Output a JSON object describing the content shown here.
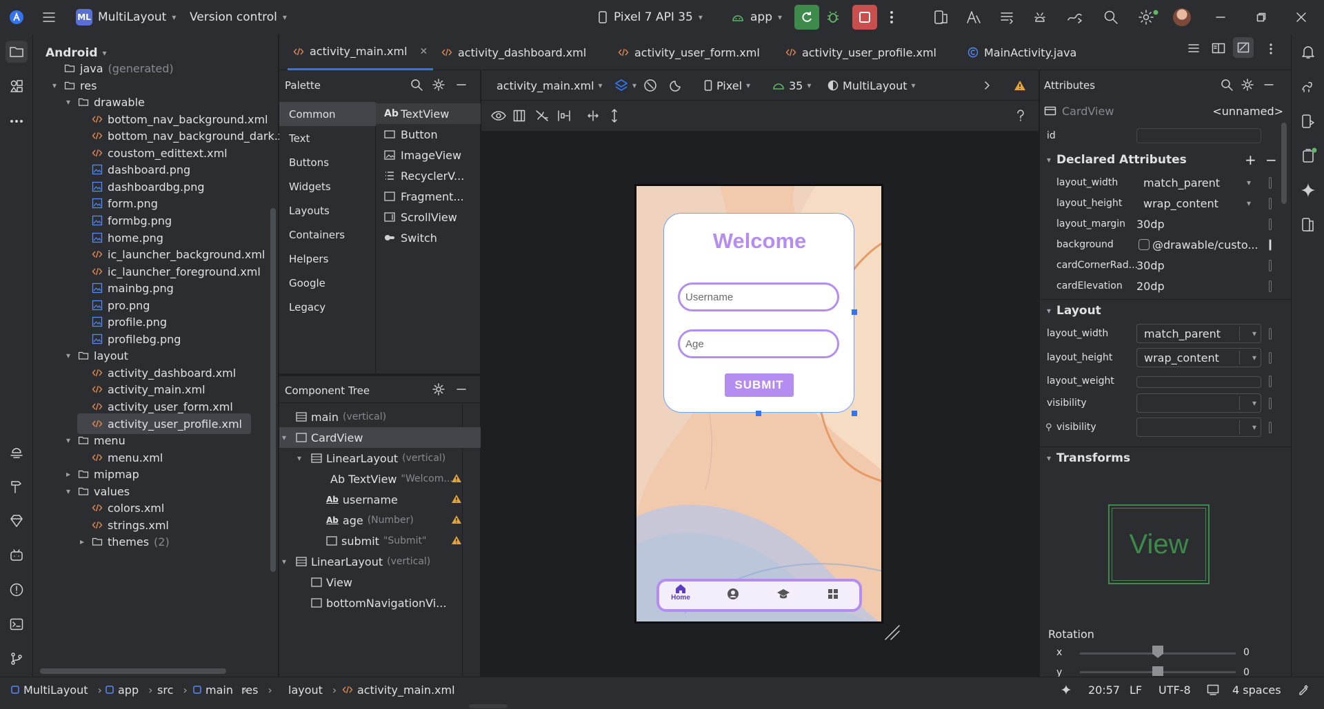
{
  "titlebar": {
    "project_badge": "ML",
    "project_name": "MultiLayout",
    "vcs": "Version control",
    "device": "Pixel 7 API 35",
    "run_config": "app"
  },
  "project_panel": {
    "title": "Android",
    "items": [
      {
        "label": "java",
        "sub": "(generated)",
        "kind": "folder"
      },
      {
        "label": "res",
        "kind": "folder"
      },
      {
        "label": "drawable",
        "kind": "folder"
      },
      {
        "label": "bottom_nav_background.xml",
        "kind": "xml"
      },
      {
        "label": "bottom_nav_background_dark.xml",
        "kind": "xml"
      },
      {
        "label": "coustom_edittext.xml",
        "kind": "xml"
      },
      {
        "label": "dashboard.png",
        "kind": "img"
      },
      {
        "label": "dashboardbg.png",
        "kind": "img"
      },
      {
        "label": "form.png",
        "kind": "img"
      },
      {
        "label": "formbg.png",
        "kind": "img"
      },
      {
        "label": "home.png",
        "kind": "img"
      },
      {
        "label": "ic_launcher_background.xml",
        "kind": "xml"
      },
      {
        "label": "ic_launcher_foreground.xml",
        "kind": "xml"
      },
      {
        "label": "mainbg.png",
        "kind": "img"
      },
      {
        "label": "pro.png",
        "kind": "img"
      },
      {
        "label": "profile.png",
        "kind": "img"
      },
      {
        "label": "profilebg.png",
        "kind": "img"
      },
      {
        "label": "layout",
        "kind": "folder"
      },
      {
        "label": "activity_dashboard.xml",
        "kind": "xml"
      },
      {
        "label": "activity_main.xml",
        "kind": "xml"
      },
      {
        "label": "activity_user_form.xml",
        "kind": "xml"
      },
      {
        "label": "activity_user_profile.xml",
        "kind": "xml"
      },
      {
        "label": "menu",
        "kind": "folder"
      },
      {
        "label": "menu.xml",
        "kind": "xml"
      },
      {
        "label": "mipmap",
        "kind": "folder"
      },
      {
        "label": "values",
        "kind": "folder"
      },
      {
        "label": "colors.xml",
        "kind": "xml"
      },
      {
        "label": "strings.xml",
        "kind": "xml"
      },
      {
        "label": "themes",
        "sub": "(2)",
        "kind": "folder"
      }
    ]
  },
  "tabs": [
    {
      "label": "activity_main.xml",
      "active": true
    },
    {
      "label": "activity_dashboard.xml"
    },
    {
      "label": "activity_user_form.xml"
    },
    {
      "label": "activity_user_profile.xml"
    },
    {
      "label": "MainActivity.java"
    }
  ],
  "palette": {
    "title": "Palette",
    "categories": [
      "Common",
      "Text",
      "Buttons",
      "Widgets",
      "Layouts",
      "Containers",
      "Helpers",
      "Google",
      "Legacy"
    ],
    "items": [
      {
        "prefix": "Ab",
        "label": "TextView"
      },
      {
        "prefix": "",
        "label": "Button"
      },
      {
        "prefix": "",
        "label": "ImageView"
      },
      {
        "prefix": "",
        "label": "RecyclerV..."
      },
      {
        "prefix": "",
        "label": "Fragment..."
      },
      {
        "prefix": "",
        "label": "ScrollView"
      },
      {
        "prefix": "",
        "label": "Switch"
      }
    ]
  },
  "component_tree": {
    "title": "Component Tree",
    "rows": [
      {
        "label": "main",
        "sub": "(vertical)"
      },
      {
        "label": "CardView",
        "sub": ""
      },
      {
        "label": "LinearLayout",
        "sub": "(vertical)"
      },
      {
        "label": "Ab TextView",
        "sub": "\"Welcom..."
      },
      {
        "label": "username",
        "sub": ""
      },
      {
        "label": "age",
        "sub": "(Number)"
      },
      {
        "label": "submit",
        "sub": "\"Submit\""
      },
      {
        "label": "LinearLayout",
        "sub": "(vertical)"
      },
      {
        "label": "View",
        "sub": ""
      },
      {
        "label": "bottomNavigationVi...",
        "sub": ""
      }
    ]
  },
  "design_toolbar": {
    "file": "activity_main.xml",
    "device": "Pixel",
    "api": "35",
    "theme": "MultiLayout"
  },
  "preview": {
    "welcome": "Welcome",
    "username_hint": "Username",
    "age_hint": "Age",
    "submit": "SUBMIT",
    "nav_home": "Home"
  },
  "attributes": {
    "title": "Attributes",
    "component": "CardView",
    "unnamed": "<unnamed>",
    "id_label": "id",
    "declared_title": "Declared Attributes",
    "declared": [
      {
        "name": "layout_width",
        "value": "match_parent"
      },
      {
        "name": "layout_height",
        "value": "wrap_content"
      },
      {
        "name": "layout_margin",
        "value": "30dp"
      },
      {
        "name": "background",
        "value": "@drawable/custo..."
      },
      {
        "name": "cardCornerRad...",
        "value": "30dp"
      },
      {
        "name": "cardElevation",
        "value": "20dp"
      }
    ],
    "layout_title": "Layout",
    "layout": [
      {
        "name": "layout_width",
        "value": "match_parent"
      },
      {
        "name": "layout_height",
        "value": "wrap_content"
      },
      {
        "name": "layout_weight",
        "value": ""
      },
      {
        "name": "visibility",
        "value": ""
      },
      {
        "name": "visibility",
        "value": ""
      }
    ],
    "transforms_title": "Transforms",
    "view_preview": "View",
    "rotation_label": "Rotation",
    "rot_x_label": "x",
    "rot_x_value": "0",
    "rot_y_label": "y",
    "rot_y_value": "0"
  },
  "statusbar": {
    "crumbs": [
      "MultiLayout",
      "app",
      "src",
      "main",
      "res",
      "layout",
      "activity_main.xml"
    ],
    "position": "20:57",
    "line_sep": "LF",
    "encoding": "UTF-8",
    "indent": "4 spaces"
  },
  "colors": {
    "accent": "#3574f0",
    "purple": "#b58df0",
    "run_green": "#3d8a4a",
    "stop_red": "#c94f4f"
  }
}
